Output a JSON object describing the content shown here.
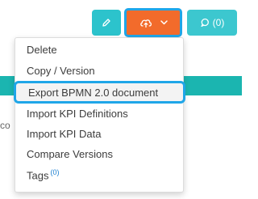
{
  "background": {
    "fragment_text": "co"
  },
  "toolbar": {
    "edit_icon": "pencil-icon",
    "export_icon": "cloud-upload-icon",
    "export_chevron_icon": "chevron-down-icon",
    "comments_icon": "chat-bubble-icon",
    "comments_count": "(0)"
  },
  "menu": {
    "items": [
      {
        "label": "Delete"
      },
      {
        "label": "Copy / Version"
      },
      {
        "label": "Export BPMN 2.0 document"
      },
      {
        "label": "Import KPI Definitions"
      },
      {
        "label": "Import KPI Data"
      },
      {
        "label": "Compare Versions"
      },
      {
        "label": "Tags",
        "badge": "(0)"
      }
    ]
  },
  "colors": {
    "teal": "#2cc3cc",
    "orange": "#f26b2b",
    "highlight_border": "#1fa6e8",
    "band": "#1bb5b0"
  }
}
